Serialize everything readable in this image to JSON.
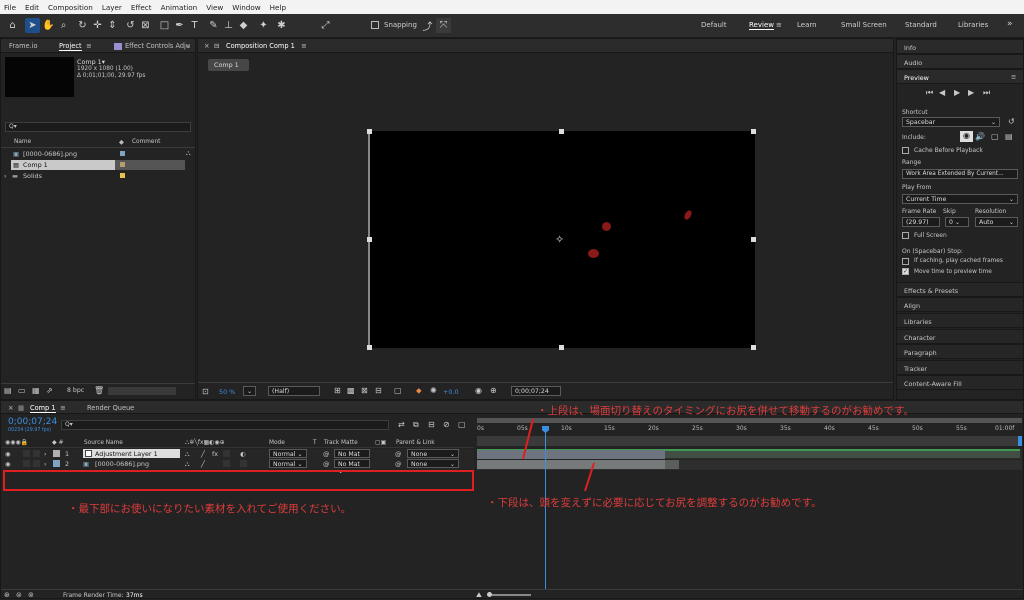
{
  "menu": [
    "File",
    "Edit",
    "Composition",
    "Layer",
    "Effect",
    "Animation",
    "View",
    "Window",
    "Help"
  ],
  "toolbar": {
    "snapping_label": "Snapping",
    "workspaces": [
      "Default",
      "Review",
      "Learn",
      "Small Screen",
      "Standard",
      "Libraries"
    ],
    "active_workspace": "Review",
    "more": "»"
  },
  "project": {
    "tabs": [
      "Frame.io",
      "Project",
      "Effect Controls Adju"
    ],
    "active_tab": "Project",
    "comp_name": "Comp 1▾",
    "comp_size": "1920 x 1080 (1.00)",
    "comp_duration": "Δ 0;01;01;00, 29.97 fps",
    "search_placeholder": "Q▾",
    "columns": [
      "Name",
      "Comment"
    ],
    "items": [
      {
        "name": "[0000-0686].png",
        "color": "#7fa3c2"
      },
      {
        "name": "Comp 1",
        "color": "#b79d6a"
      },
      {
        "name": "Solids",
        "color": "#e8c34a"
      }
    ],
    "bpc": "8 bpc"
  },
  "composition": {
    "tab": "Composition Comp 1",
    "subtab": "Comp 1",
    "zoom": "50 %",
    "resolution": "(Half)",
    "exposure": "+0.0",
    "timecode": "0;00;07;24"
  },
  "right": {
    "sections": [
      "Info",
      "Audio",
      "Preview"
    ],
    "shortcut_label": "Shortcut",
    "shortcut_value": "Spacebar",
    "include_label": "Include:",
    "cache_before": "Cache Before Playback",
    "range_label": "Range",
    "range_value": "Work Area Extended By Current...",
    "play_from_label": "Play From",
    "play_from_value": "Current Time",
    "frame_rate_label": "Frame Rate",
    "skip_label": "Skip",
    "resolution_label": "Resolution",
    "frame_rate_value": "(29.97)",
    "skip_value": "0",
    "resolution_value": "Auto",
    "full_screen": "Full Screen",
    "on_stop_label": "On (Spacebar) Stop:",
    "if_caching": "If caching, play cached frames",
    "move_time": "Move time to preview time",
    "panels": [
      "Effects & Presets",
      "Align",
      "Libraries",
      "Character",
      "Paragraph",
      "Tracker",
      "Content-Aware Fill"
    ]
  },
  "timeline": {
    "tabs": [
      "Comp 1",
      "Render Queue"
    ],
    "timecode": "0;00;07;24",
    "timecode_sub": "00234 (29.97 fps)",
    "search_placeholder": "Q▾",
    "col_source": "Source Name",
    "col_mode": "Mode",
    "col_t": "T",
    "col_trackmatte": "Track Matte",
    "col_parent": "Parent & Link",
    "ticks": [
      "0s",
      "05s",
      "10s",
      "15s",
      "20s",
      "25s",
      "30s",
      "35s",
      "40s",
      "45s",
      "50s",
      "55s",
      "01:00f"
    ],
    "layers": [
      {
        "num": "1",
        "name": "Adjustment Layer 1",
        "mode": "Normal",
        "matte": "No Mat",
        "parent": "None"
      },
      {
        "num": "2",
        "name": "[0000-0686].png",
        "mode": "Normal",
        "matte": "No Mat",
        "parent": "None"
      }
    ],
    "frame_render_label": "Frame Render Time:",
    "frame_render_value": "37ms"
  },
  "annotations": {
    "top": "・上段は、場面切り替えのタイミングにお尻を併せて移動するのがお勧めです。",
    "bottom_right": "・下段は、頭を変えずに必要に応じてお尻を調整するのがお勧めです。",
    "bottom_left": "・最下部にお使いになりたい素材を入れてご使用ください。"
  },
  "colors": {
    "accent": "#2d8ceb",
    "annotation": "#e03c3c",
    "active_tool": "#1e4f8a"
  }
}
